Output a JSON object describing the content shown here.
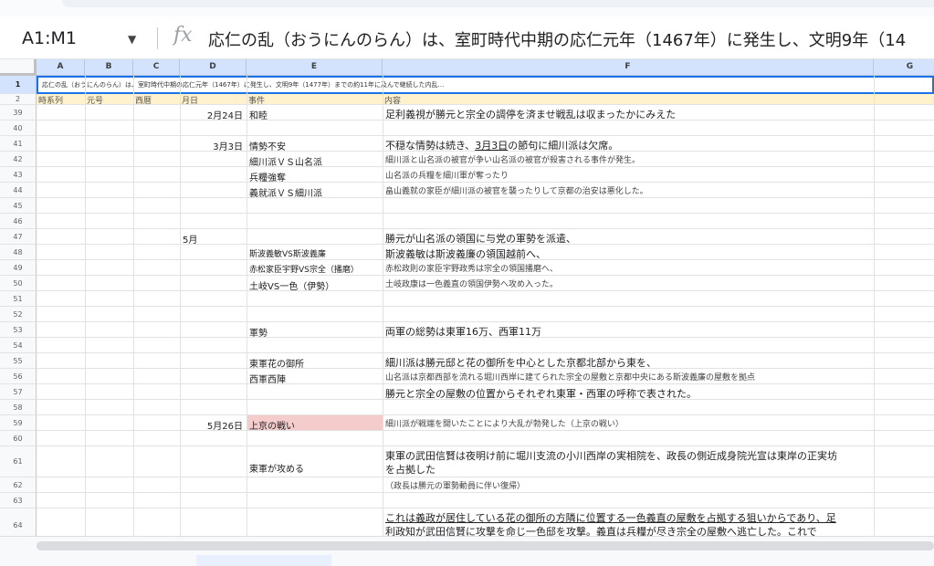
{
  "formula_bar": {
    "name_box": "A1:M1",
    "fx_label": "fx",
    "formula_text": "応仁の乱（おうにんのらん）は、室町時代中期の応仁元年（1467年）に発生し、文明9年（14"
  },
  "columns": [
    "A",
    "B",
    "C",
    "D",
    "E",
    "F",
    "G"
  ],
  "row1_text": "応仁の乱（おうにんのらん）は、室町時代中期の応仁元年（1467年）に発生し、文明9年（1477年）までの約11年に及んで継続した内乱...",
  "headers": {
    "A": "時系列",
    "B": "元号",
    "C": "西暦",
    "D": "月日",
    "E": "事件",
    "F": "内容"
  },
  "rows": [
    {
      "n": "39",
      "D": "2月24日",
      "E": "和睦",
      "F": "足利義視が勝元と宗全の調停を済ませ戦乱は収まったかにみえた"
    },
    {
      "n": "40",
      "D": "",
      "E": "",
      "F": ""
    },
    {
      "n": "41",
      "D": "3月3日",
      "E": "情勢不安",
      "F": "不穏な情勢は続き、3月3日の節句に細川派は欠席。"
    },
    {
      "n": "42",
      "D": "",
      "E": "細川派ＶＳ山名派",
      "F": "細川派と山名派の被官が争い山名派の被官が殺害される事件が発生。"
    },
    {
      "n": "43",
      "D": "",
      "E": "兵糧強奪",
      "F": "山名派の兵糧を細川軍が奪ったり"
    },
    {
      "n": "44",
      "D": "",
      "E": "義就派ＶＳ細川派",
      "F": "畠山義就の家臣が細川派の被官を襲ったりして京都の治安は悪化した。"
    },
    {
      "n": "45",
      "D": "",
      "E": "",
      "F": ""
    },
    {
      "n": "46",
      "D": "",
      "E": "",
      "F": ""
    },
    {
      "n": "47",
      "D": "5月",
      "E": "",
      "F": "勝元が山名派の領国に与党の軍勢を派遣、"
    },
    {
      "n": "48",
      "D": "",
      "E": "斯波義敏VS斯波義廉",
      "F": "斯波義敏は斯波義廉の領国越前へ、"
    },
    {
      "n": "49",
      "D": "",
      "E": "赤松家臣宇野VS宗全（播磨）",
      "F": "赤松政則の家臣宇野政秀は宗全の領国播磨へ、"
    },
    {
      "n": "50",
      "D": "",
      "E": "土岐VS一色（伊勢）",
      "F": "土岐政康は一色義直の領国伊勢へ攻め入った。"
    },
    {
      "n": "51",
      "D": "",
      "E": "",
      "F": ""
    },
    {
      "n": "52",
      "D": "",
      "E": "",
      "F": ""
    },
    {
      "n": "53",
      "D": "",
      "E": "軍勢",
      "F": "両軍の総勢は東軍16万、西軍11万"
    },
    {
      "n": "54",
      "D": "",
      "E": "",
      "F": ""
    },
    {
      "n": "55",
      "D": "",
      "E": "東軍花の御所",
      "F": "細川派は勝元邸と花の御所を中心とした京都北部から東を、"
    },
    {
      "n": "56",
      "D": "",
      "E": "西軍西陣",
      "F": "山名派は京都西部を流れる堀川西岸に建てられた宗全の屋敷と京都中央にある斯波義廉の屋敷を拠点"
    },
    {
      "n": "57",
      "D": "",
      "E": "",
      "F": "勝元と宗全の屋敷の位置からそれぞれ東軍・西軍の呼称で表された。"
    },
    {
      "n": "58",
      "D": "",
      "E": "",
      "F": ""
    },
    {
      "n": "59",
      "D": "5月26日",
      "E": "上京の戦い",
      "F": "細川派が戦端を開いたことにより大乱が勃発した（上京の戦い）"
    },
    {
      "n": "60",
      "D": "",
      "E": "",
      "F": ""
    },
    {
      "n": "61",
      "D": "",
      "E": "東軍が攻める",
      "F": "東軍の武田信賢は夜明け前に堀川支流の小川西岸の実相院を、政長の側近成身院光宣は東岸の正実坊",
      "F2": "を占拠した"
    },
    {
      "n": "62",
      "D": "",
      "E": "",
      "F": "（政長は勝元の軍勢動員に伴い復帰）"
    },
    {
      "n": "63",
      "D": "",
      "E": "",
      "F": ""
    },
    {
      "n": "64",
      "D": "",
      "E": "",
      "F": "これは義政が居住している花の御所の方隣に位置する一色義直の屋敷を占拠する狙いからであり、足",
      "F2": "利政知が武田信賢に攻撃を命じ一色邸を攻撃。義直は兵糧が尽き宗全の屋敷へ逃亡した。これで"
    }
  ],
  "colors": {
    "accent": "#1a73e8",
    "header_blue": "#d3e3fd",
    "row2_yellow": "#fff2cc",
    "highlight_red": "#f4cccc"
  }
}
